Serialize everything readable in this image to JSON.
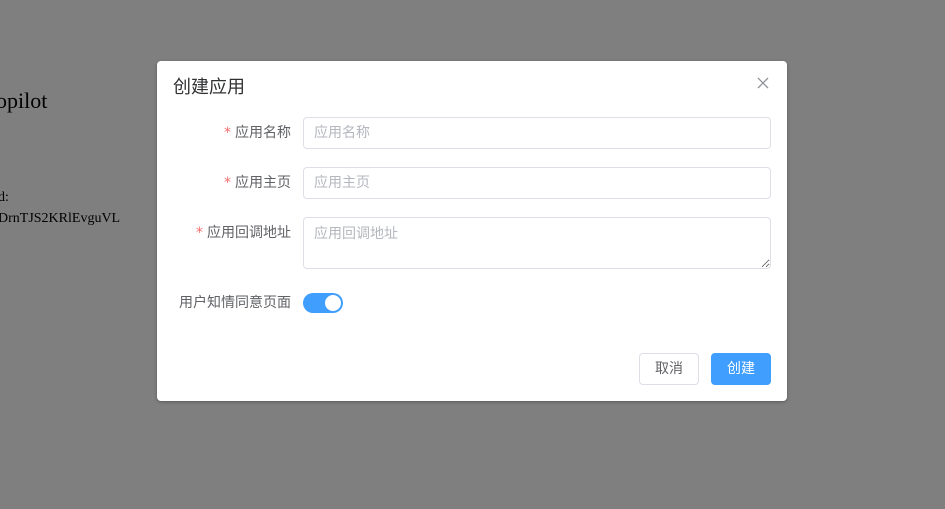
{
  "background": {
    "title": "opilot",
    "label": "d:",
    "value": "DrnTJS2KRlEvguVL"
  },
  "dialog": {
    "title": "创建应用",
    "close_icon": "close-icon",
    "fields": {
      "app_name": {
        "required_mark": "*",
        "label": "应用名称",
        "placeholder": "应用名称",
        "value": ""
      },
      "app_homepage": {
        "required_mark": "*",
        "label": "应用主页",
        "placeholder": "应用主页",
        "value": ""
      },
      "app_callback": {
        "required_mark": "*",
        "label": "应用回调地址",
        "placeholder": "应用回调地址",
        "value": ""
      },
      "consent_page": {
        "label": "用户知情同意页面",
        "enabled": true
      }
    },
    "buttons": {
      "cancel": "取消",
      "create": "创建"
    }
  },
  "colors": {
    "primary": "#409eff",
    "required": "#f56c6c",
    "overlay": "rgba(0,0,0,0.5)"
  }
}
